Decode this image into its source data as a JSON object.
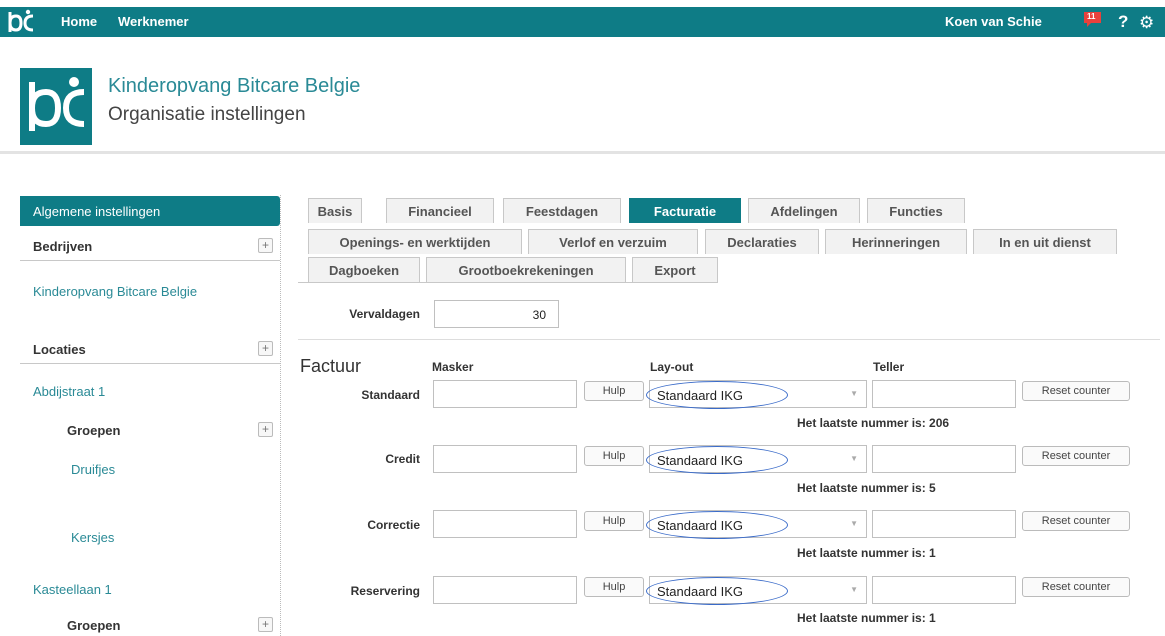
{
  "topbar": {
    "nav": [
      "Home",
      "Werknemer"
    ],
    "user": "Koen van Schie",
    "notification_count": "11",
    "help_label": "?"
  },
  "header": {
    "org_name": "Kinderopvang Bitcare Belgie",
    "page_title": "Organisatie instellingen"
  },
  "sidebar": {
    "active": "Algemene instellingen",
    "bedrijven": "Bedrijven",
    "company": "Kinderopvang Bitcare Belgie",
    "locaties": "Locaties",
    "location1": "Abdijstraat 1",
    "groepen1": "Groepen",
    "group1": "Druifjes",
    "group2": "Kersjes",
    "location2": "Kasteellaan 1",
    "groepen2": "Groepen"
  },
  "tabs": {
    "row1": [
      "Basis",
      "Financieel",
      "Feestdagen",
      "Facturatie",
      "Afdelingen",
      "Functies"
    ],
    "row2": [
      "Openings- en werktijden",
      "Verlof en verzuim",
      "Declaraties",
      "Herinneringen",
      "In en uit dienst"
    ],
    "row3": [
      "Dagboeken",
      "Grootboekrekeningen",
      "Export"
    ],
    "active": "Facturatie"
  },
  "form": {
    "vervaldagen_label": "Vervaldagen",
    "vervaldagen_value": "30",
    "section_title": "Factuur",
    "col_masker": "Masker",
    "col_layout": "Lay-out",
    "col_teller": "Teller",
    "hulp_label": "Hulp",
    "reset_label": "Reset counter",
    "rows": [
      {
        "label": "Standaard",
        "layout": "Standaard IKG",
        "info": "Het laatste nummer is: 206"
      },
      {
        "label": "Credit",
        "layout": "Standaard IKG",
        "info": "Het laatste nummer is: 5"
      },
      {
        "label": "Correctie",
        "layout": "Standaard IKG",
        "info": "Het laatste nummer is: 1"
      },
      {
        "label": "Reservering",
        "layout": "Standaard IKG",
        "info": "Het laatste nummer is: 1"
      }
    ]
  },
  "colors": {
    "accent": "#0e7c86",
    "link": "#2a8a96",
    "highlight_oval": "#3a6bc9"
  }
}
